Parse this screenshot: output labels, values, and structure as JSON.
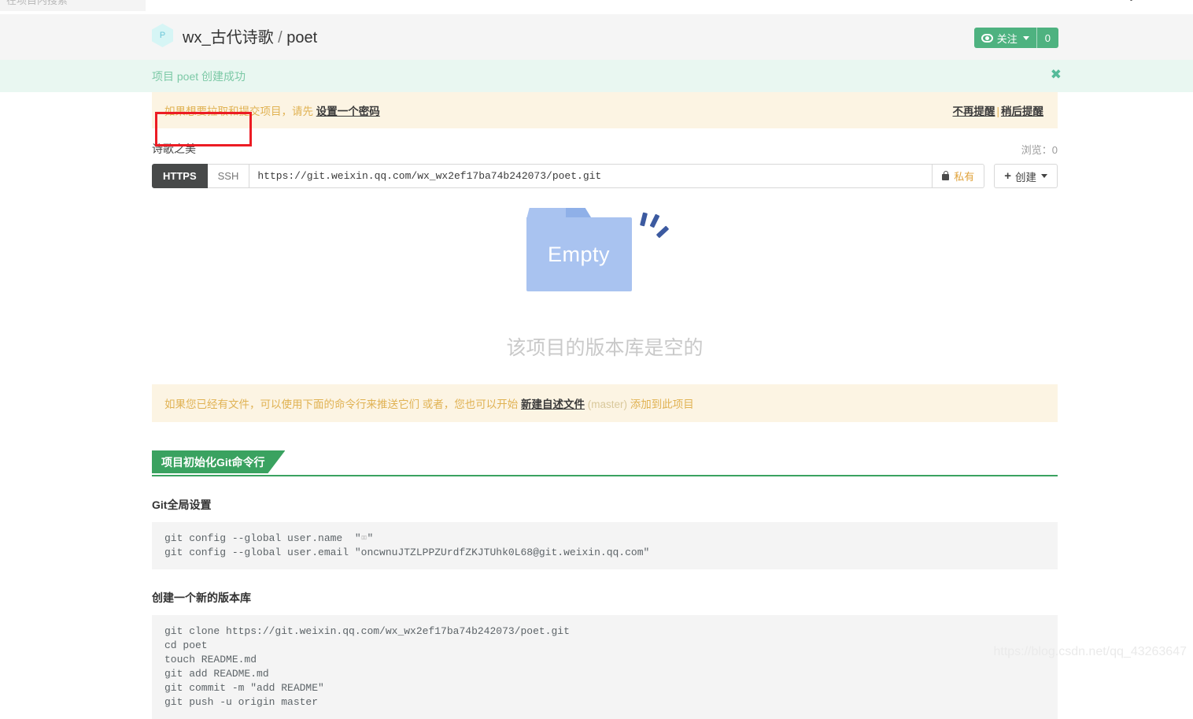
{
  "topnav": {
    "search_placeholder": "在项目内搜索",
    "user_menu_icon": "vertical-dots-icon",
    "add_menu_icon": "plus-icon"
  },
  "header": {
    "avatar_letter": "P",
    "owner": "wx_古代诗歌",
    "separator": "/",
    "repo": "poet",
    "watch": {
      "label": "关注",
      "count": "0",
      "icon": "eye-icon"
    }
  },
  "success_banner": {
    "message": "项目 poet 创建成功",
    "close": "✖"
  },
  "password_alert": {
    "prefix": "如果想要拉取和提交项目，请先",
    "link": "设置一个密码",
    "dismiss_forever": "不再提醒",
    "divider": "|",
    "dismiss_later": "稍后提醒"
  },
  "repo_meta": {
    "description": "诗歌之美",
    "views_label": "浏览：",
    "views_count": "0"
  },
  "clone": {
    "protocol_https": "HTTPS",
    "protocol_ssh": "SSH",
    "url": "https://git.weixin.qq.com/wx_wx2ef17ba74b242073/poet.git",
    "privacy": "私有",
    "privacy_icon": "lock-icon",
    "create_label": "创建",
    "create_icon": "plus-icon"
  },
  "empty_state": {
    "folder_label": "Empty",
    "message": "该项目的版本库是空的"
  },
  "info_alert": {
    "part1": "如果您已经有文件，可以使用下面的命令行来推送它们 或者，您也可以开始",
    "link": "新建自述文件",
    "branch": "(master)",
    "part2": "添加到此项目"
  },
  "git_section": {
    "header": "项目初始化Git命令行",
    "global_config": {
      "title": "Git全局设置",
      "line1_prefix": "git config --global user.name  \"",
      "line1_value": "⌧",
      "line1_suffix": "\"",
      "line2": "git config --global user.email \"oncwnuJTZLPPZUrdfZKJTUhk0L68@git.weixin.qq.com\""
    },
    "new_repo": {
      "title": "创建一个新的版本库",
      "lines": [
        "git clone https://git.weixin.qq.com/wx_wx2ef17ba74b242073/poet.git",
        "cd poet",
        "touch README.md",
        "git add README.md",
        "git commit -m \"add README\"",
        "git push -u origin master"
      ]
    }
  },
  "watermark": "https://blog.csdn.net/qq_43263647",
  "colors": {
    "brand_green": "#3aa260",
    "watch_green": "#4eb280",
    "success_bg": "#e9f7f1",
    "warn_bg": "#fcf4e3",
    "warn_text": "#e0b253",
    "folder_blue": "#a9c3f0",
    "annotation_red": "#ec1c24"
  }
}
